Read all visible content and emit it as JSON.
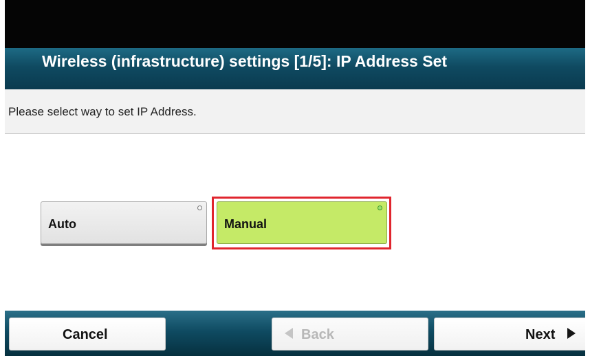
{
  "screen": {
    "title": "Wireless (infrastructure) settings [1/5]: IP Address Set",
    "instruction": "Please select way to set IP Address."
  },
  "options": {
    "auto_label": "Auto",
    "manual_label": "Manual",
    "selected": "Manual"
  },
  "navigation": {
    "cancel_label": "Cancel",
    "back_label": "Back",
    "next_label": "Next",
    "back_enabled": false
  },
  "icons": {
    "back": "triangle-left-icon",
    "next": "triangle-right-icon",
    "indicator_off": "radio-indicator-off-icon",
    "indicator_on": "radio-indicator-on-icon"
  },
  "colors": {
    "title_bar": "#0f4a61",
    "selected_option": "#c5ea67",
    "selection_frame": "#e0252e",
    "bottom_bar": "#0f4b62"
  }
}
